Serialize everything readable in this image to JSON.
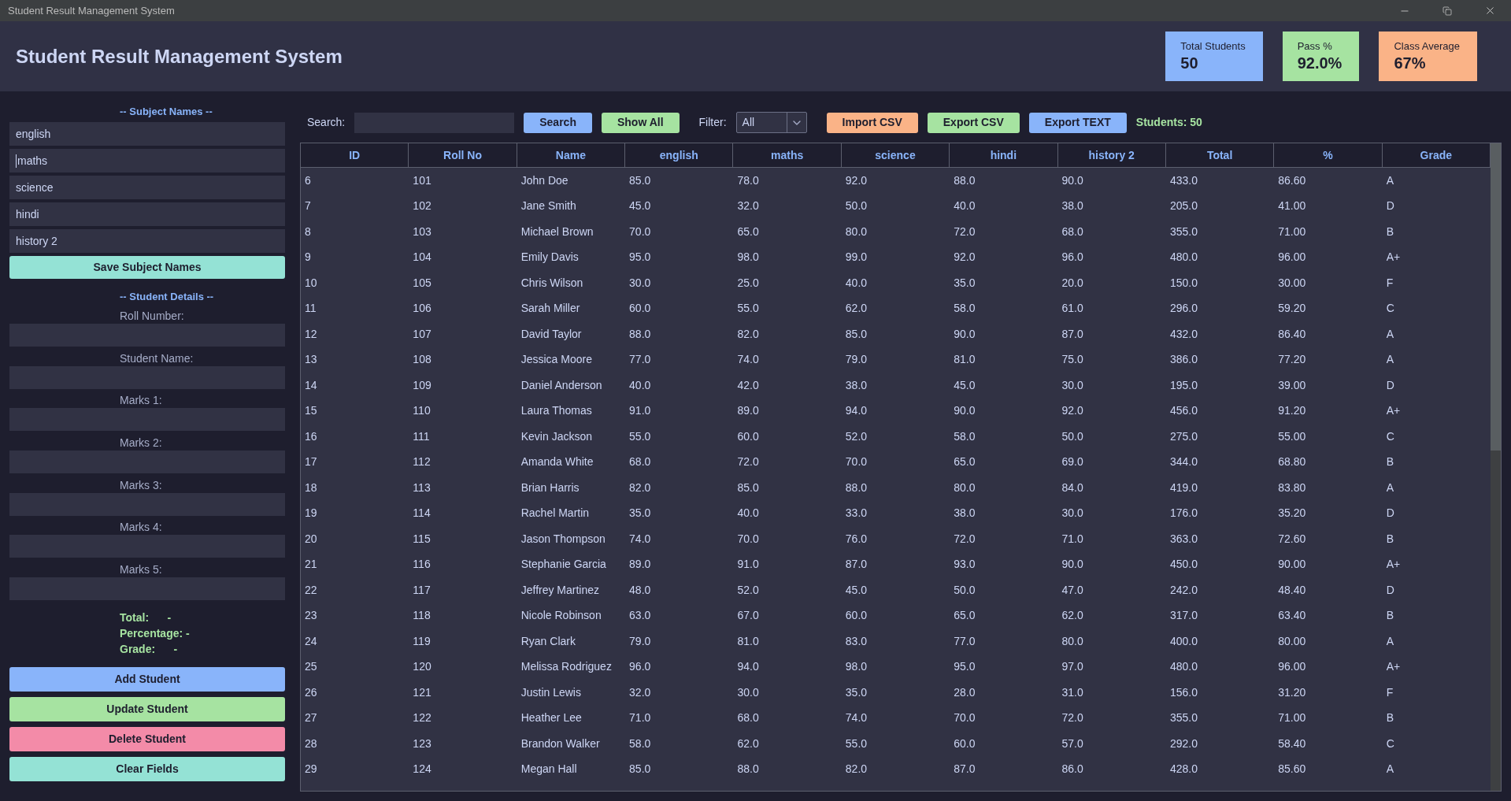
{
  "window": {
    "title": "Student Result Management System"
  },
  "header": {
    "title": "Student Result Management System",
    "stats": [
      {
        "label": "Total Students",
        "value": "50",
        "color": "#89b4fa"
      },
      {
        "label": "Pass %",
        "value": "92.0%",
        "color": "#a6e3a1"
      },
      {
        "label": "Class Average",
        "value": "67%",
        "color": "#fab387"
      }
    ]
  },
  "sidebar": {
    "subject_names": {
      "heading": "-- Subject Names --",
      "fields": [
        {
          "value": "english",
          "focused": false
        },
        {
          "value": "maths",
          "focused": true
        },
        {
          "value": "science",
          "focused": false
        },
        {
          "value": "hindi",
          "focused": false
        },
        {
          "value": "history 2",
          "focused": false
        }
      ],
      "save_button": {
        "label": "Save Subject Names",
        "color": "#94e2d5"
      }
    },
    "student_details": {
      "heading": "-- Student Details --",
      "fields": [
        {
          "label": "Roll Number:"
        },
        {
          "label": "Student Name:"
        },
        {
          "label": "Marks 1:"
        },
        {
          "label": "Marks 2:"
        },
        {
          "label": "Marks 3:"
        },
        {
          "label": "Marks 4:"
        },
        {
          "label": "Marks 5:"
        }
      ]
    },
    "summary": [
      "Total:      -",
      "Percentage: -",
      "Grade:      -"
    ],
    "buttons": [
      {
        "label": "Add Student",
        "color": "#89b4fa"
      },
      {
        "label": "Update Student",
        "color": "#a6e3a1"
      },
      {
        "label": "Delete Student",
        "color": "#f38ba8"
      },
      {
        "label": "Clear Fields",
        "color": "#94e2d5"
      }
    ]
  },
  "toolbar": {
    "groups": [
      [
        {
          "kind": "label",
          "text": "Search:"
        },
        {
          "kind": "field"
        },
        {
          "kind": "button",
          "label": "Search",
          "color": "#89b4fa"
        },
        {
          "kind": "button",
          "label": "Show All",
          "color": "#a6e3a1"
        }
      ],
      [
        {
          "kind": "label",
          "text": "Filter:"
        },
        {
          "kind": "dropdown",
          "value": "All"
        }
      ],
      [
        {
          "kind": "button",
          "label": "Import CSV",
          "color": "#fab387"
        },
        {
          "kind": "button",
          "label": "Export CSV",
          "color": "#a6e3a1"
        },
        {
          "kind": "button",
          "label": "Export TEXT",
          "color": "#89b4fa"
        },
        {
          "kind": "status",
          "text": "Students: 50"
        }
      ]
    ]
  },
  "table": {
    "columns": [
      "ID",
      "Roll No",
      "Name",
      "english",
      "maths",
      "science",
      "hindi",
      "history 2",
      "Total",
      "%",
      "Grade"
    ],
    "rows": [
      [
        "6",
        "101",
        "John Doe",
        "85.0",
        "78.0",
        "92.0",
        "88.0",
        "90.0",
        "433.0",
        "86.60",
        "A"
      ],
      [
        "7",
        "102",
        "Jane Smith",
        "45.0",
        "32.0",
        "50.0",
        "40.0",
        "38.0",
        "205.0",
        "41.00",
        "D"
      ],
      [
        "8",
        "103",
        "Michael Brown",
        "70.0",
        "65.0",
        "80.0",
        "72.0",
        "68.0",
        "355.0",
        "71.00",
        "B"
      ],
      [
        "9",
        "104",
        "Emily Davis",
        "95.0",
        "98.0",
        "99.0",
        "92.0",
        "96.0",
        "480.0",
        "96.00",
        "A+"
      ],
      [
        "10",
        "105",
        "Chris Wilson",
        "30.0",
        "25.0",
        "40.0",
        "35.0",
        "20.0",
        "150.0",
        "30.00",
        "F"
      ],
      [
        "11",
        "106",
        "Sarah Miller",
        "60.0",
        "55.0",
        "62.0",
        "58.0",
        "61.0",
        "296.0",
        "59.20",
        "C"
      ],
      [
        "12",
        "107",
        "David Taylor",
        "88.0",
        "82.0",
        "85.0",
        "90.0",
        "87.0",
        "432.0",
        "86.40",
        "A"
      ],
      [
        "13",
        "108",
        "Jessica Moore",
        "77.0",
        "74.0",
        "79.0",
        "81.0",
        "75.0",
        "386.0",
        "77.20",
        "A"
      ],
      [
        "14",
        "109",
        "Daniel Anderson",
        "40.0",
        "42.0",
        "38.0",
        "45.0",
        "30.0",
        "195.0",
        "39.00",
        "D"
      ],
      [
        "15",
        "110",
        "Laura Thomas",
        "91.0",
        "89.0",
        "94.0",
        "90.0",
        "92.0",
        "456.0",
        "91.20",
        "A+"
      ],
      [
        "16",
        "111",
        "Kevin Jackson",
        "55.0",
        "60.0",
        "52.0",
        "58.0",
        "50.0",
        "275.0",
        "55.00",
        "C"
      ],
      [
        "17",
        "112",
        "Amanda White",
        "68.0",
        "72.0",
        "70.0",
        "65.0",
        "69.0",
        "344.0",
        "68.80",
        "B"
      ],
      [
        "18",
        "113",
        "Brian Harris",
        "82.0",
        "85.0",
        "88.0",
        "80.0",
        "84.0",
        "419.0",
        "83.80",
        "A"
      ],
      [
        "19",
        "114",
        "Rachel Martin",
        "35.0",
        "40.0",
        "33.0",
        "38.0",
        "30.0",
        "176.0",
        "35.20",
        "D"
      ],
      [
        "20",
        "115",
        "Jason Thompson",
        "74.0",
        "70.0",
        "76.0",
        "72.0",
        "71.0",
        "363.0",
        "72.60",
        "B"
      ],
      [
        "21",
        "116",
        "Stephanie Garcia",
        "89.0",
        "91.0",
        "87.0",
        "93.0",
        "90.0",
        "450.0",
        "90.00",
        "A+"
      ],
      [
        "22",
        "117",
        "Jeffrey Martinez",
        "48.0",
        "52.0",
        "45.0",
        "50.0",
        "47.0",
        "242.0",
        "48.40",
        "D"
      ],
      [
        "23",
        "118",
        "Nicole Robinson",
        "63.0",
        "67.0",
        "60.0",
        "65.0",
        "62.0",
        "317.0",
        "63.40",
        "B"
      ],
      [
        "24",
        "119",
        "Ryan Clark",
        "79.0",
        "81.0",
        "83.0",
        "77.0",
        "80.0",
        "400.0",
        "80.00",
        "A"
      ],
      [
        "25",
        "120",
        "Melissa Rodriguez",
        "96.0",
        "94.0",
        "98.0",
        "95.0",
        "97.0",
        "480.0",
        "96.00",
        "A+"
      ],
      [
        "26",
        "121",
        "Justin Lewis",
        "32.0",
        "30.0",
        "35.0",
        "28.0",
        "31.0",
        "156.0",
        "31.20",
        "F"
      ],
      [
        "27",
        "122",
        "Heather Lee",
        "71.0",
        "68.0",
        "74.0",
        "70.0",
        "72.0",
        "355.0",
        "71.00",
        "B"
      ],
      [
        "28",
        "123",
        "Brandon Walker",
        "58.0",
        "62.0",
        "55.0",
        "60.0",
        "57.0",
        "292.0",
        "58.40",
        "C"
      ],
      [
        "29",
        "124",
        "Megan Hall",
        "85.0",
        "88.0",
        "82.0",
        "87.0",
        "86.0",
        "428.0",
        "85.60",
        "A"
      ]
    ]
  }
}
